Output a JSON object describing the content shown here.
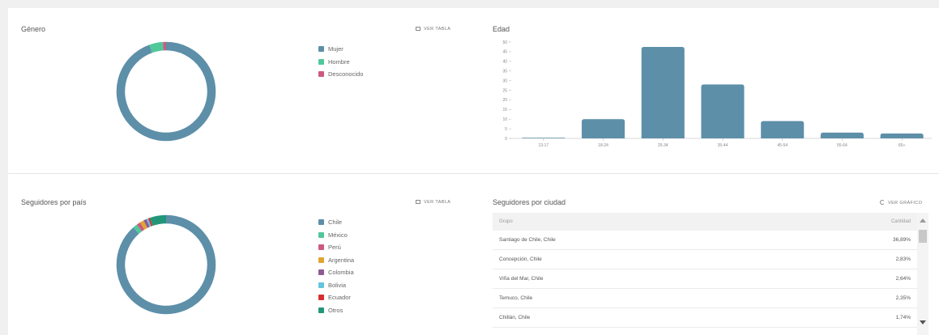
{
  "gender": {
    "title": "Género",
    "link": "VER TABLA",
    "legend": [
      {
        "label": "Mujer",
        "color": "#5d8fa9",
        "value": 94.5
      },
      {
        "label": "Hombre",
        "color": "#50c89a",
        "value": 4.5
      },
      {
        "label": "Desconocido",
        "color": "#cc5a7e",
        "value": 1.0
      }
    ]
  },
  "age": {
    "title": "Edad"
  },
  "chart_data": {
    "type": "bar",
    "categories": [
      "13-17",
      "18-24",
      "25-34",
      "35-44",
      "45-54",
      "55-64",
      "65+"
    ],
    "values": [
      0.3,
      10,
      47.5,
      28,
      9,
      3,
      2.5
    ],
    "ylim": [
      0,
      50
    ],
    "yticks": [
      0,
      5,
      10,
      15,
      20,
      25,
      30,
      35,
      40,
      45,
      50
    ],
    "color": "#5d8fa9",
    "grid": false
  },
  "country": {
    "title": "Seguidores por país",
    "link": "VER TABLA",
    "legend": [
      {
        "label": "Chile",
        "color": "#5d8fa9",
        "value": 88.5
      },
      {
        "label": "México",
        "color": "#50c89a",
        "value": 1.5
      },
      {
        "label": "Perú",
        "color": "#cc5a7e",
        "value": 1.2
      },
      {
        "label": "Argentina",
        "color": "#e0a532",
        "value": 1.3
      },
      {
        "label": "Colombia",
        "color": "#8e5a95",
        "value": 1.0
      },
      {
        "label": "Bolivia",
        "color": "#62c4df",
        "value": 0.6
      },
      {
        "label": "Ecuador",
        "color": "#d62f2f",
        "value": 0.6
      },
      {
        "label": "Otros",
        "color": "#23967a",
        "value": 5.3
      }
    ]
  },
  "city": {
    "title": "Seguidores por ciudad",
    "link": "VER GRÁFICO",
    "header_group": "Grupo",
    "header_amount": "Cantidad",
    "rows": [
      {
        "group": "Santiago de Chile, Chile",
        "amount": "36,89%"
      },
      {
        "group": "Concepción, Chile",
        "amount": "2,83%"
      },
      {
        "group": "Viña del Mar, Chile",
        "amount": "2,64%"
      },
      {
        "group": "Temuco, Chile",
        "amount": "2,35%"
      },
      {
        "group": "Chillán, Chile",
        "amount": "1,74%"
      }
    ]
  }
}
